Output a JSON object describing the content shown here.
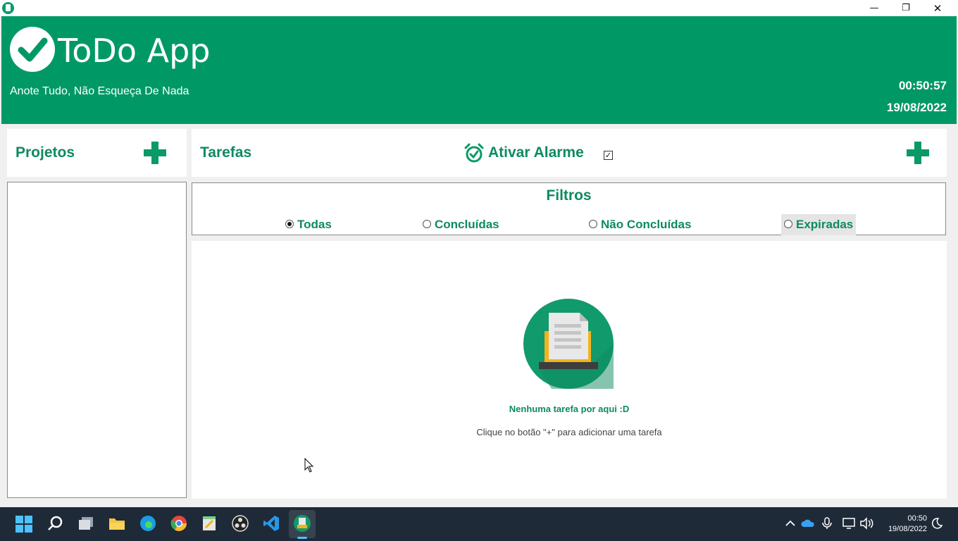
{
  "window": {
    "minimize_glyph": "—",
    "maximize_glyph": "❐",
    "close_glyph": "✕"
  },
  "header": {
    "title": "ToDo App",
    "subtitle": "Anote Tudo, Não Esqueça De Nada",
    "time": "00:50:57",
    "date": "19/08/2022",
    "brand_color": "#009966"
  },
  "projects": {
    "title": "Projetos",
    "add_icon": "plus-icon"
  },
  "tasks": {
    "title": "Tarefas",
    "alarm_label": "Ativar Alarme",
    "alarm_checked": true,
    "alarm_check_glyph": "✓",
    "add_icon": "plus-icon"
  },
  "filters": {
    "title": "Filtros",
    "options": [
      {
        "label": "Todas",
        "selected": true
      },
      {
        "label": "Concluídas",
        "selected": false
      },
      {
        "label": "Não Concluídas",
        "selected": false
      },
      {
        "label": "Expiradas",
        "selected": false
      }
    ]
  },
  "empty_state": {
    "title": "Nenhuma tarefa por aqui :D",
    "subtitle": "Clique no botão \"+\" para adicionar uma tarefa"
  },
  "taskbar": {
    "time": "00:50",
    "date": "19/08/2022"
  }
}
